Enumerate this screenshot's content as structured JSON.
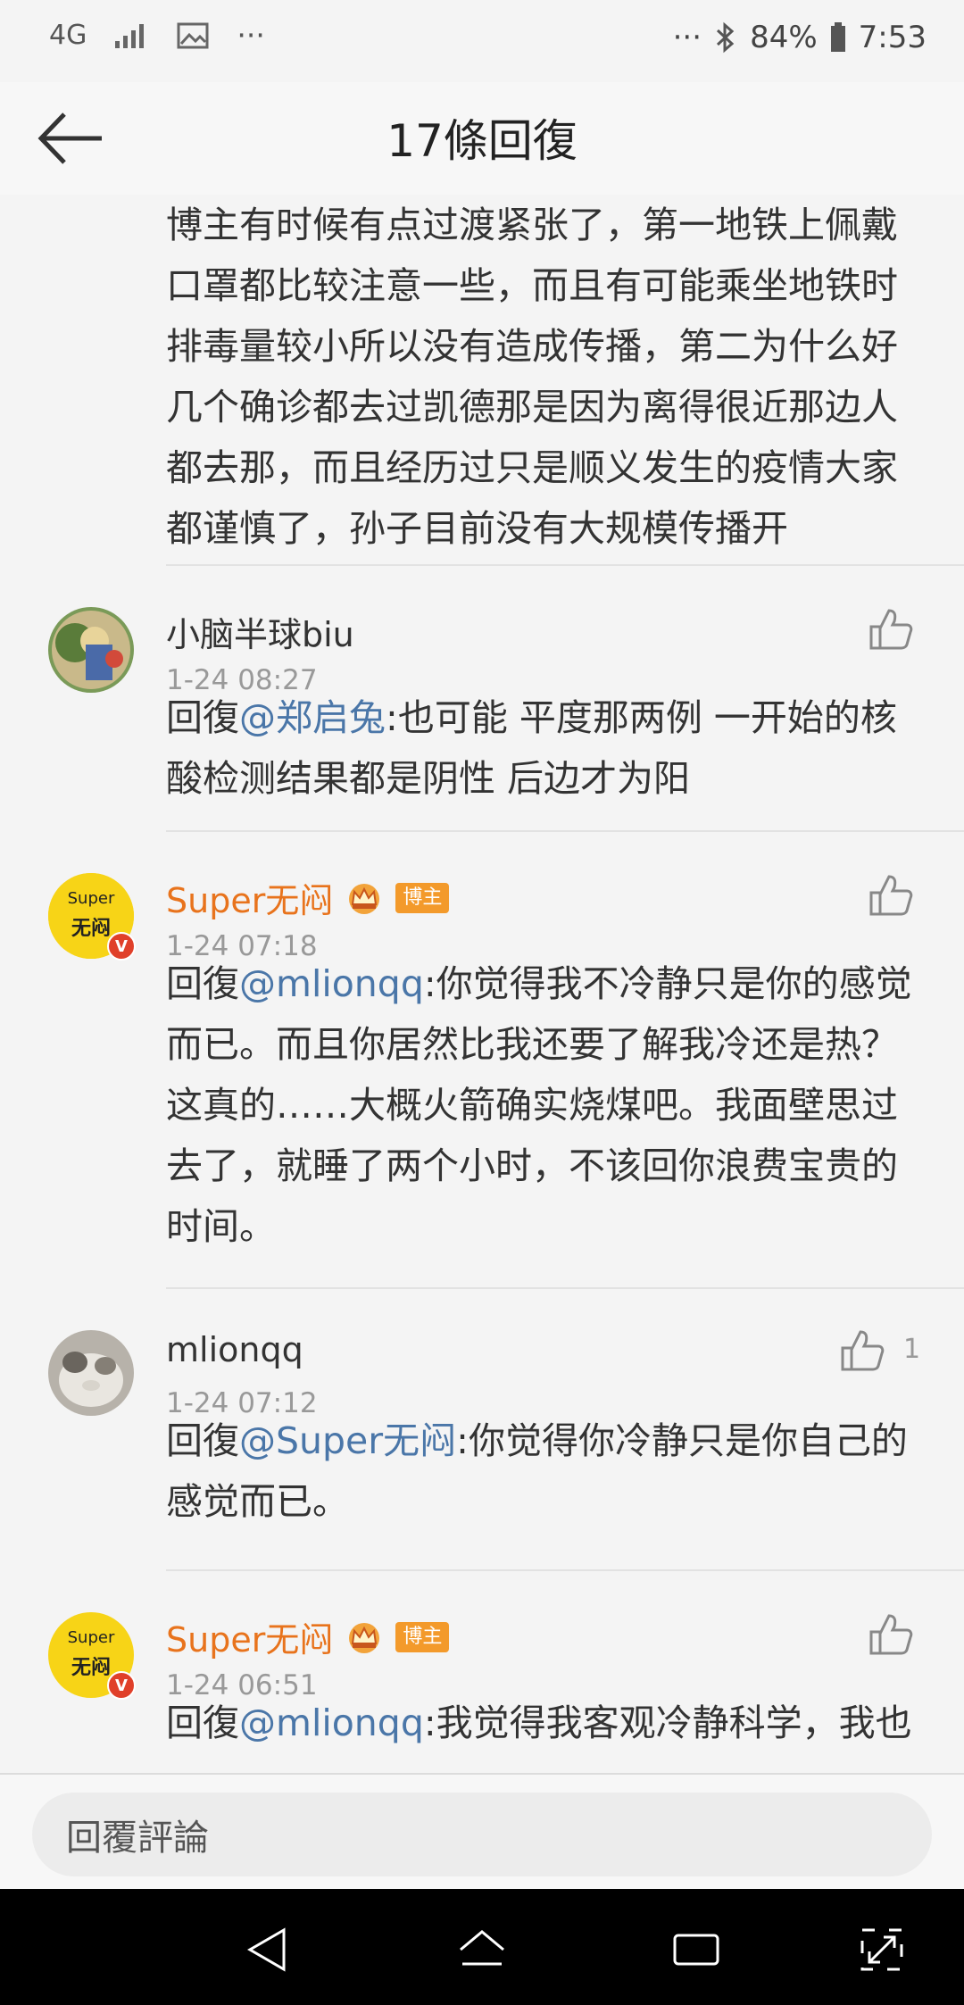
{
  "status_bar": {
    "network": "4G",
    "battery": "84%",
    "time": "7:53",
    "dots_left": "···",
    "dots_right": "···"
  },
  "header": {
    "title": "17條回復"
  },
  "first_comment_text": "博主有时候有点过渡紧张了，第一地铁上佩戴口罩都比较注意一些，而且有可能乘坐地铁时排毒量较小所以没有造成传播，第二为什么好几个确诊都去过凯德那是因为离得很近那边人都去那，而且经历过只是顺义发生的疫情大家都谨慎了，孙子目前没有大规模传播开",
  "comments": [
    {
      "name": "小脑半球biu",
      "time": "1-24 08:27",
      "reply_prefix": "回復",
      "mention": "@郑启兔",
      "text": ":也可能 平度那两例 一开始的核酸检测结果都是阴性 后边才为阳"
    },
    {
      "name": "Super无闷",
      "badge": "博主",
      "time": "1-24 07:18",
      "reply_prefix": "回復",
      "mention": "@mlionqq",
      "text": ":你觉得我不冷静只是你的感觉而已。而且你居然比我还要了解我冷还是热？这真的……大概火箭确实烧煤吧。我面壁思过去了，就睡了两个小时，不该回你浪费宝贵的时间。"
    },
    {
      "name": "mlionqq",
      "time": "1-24 07:12",
      "likes": "1",
      "reply_prefix": "回復",
      "mention": "@Super无闷",
      "text": ":你觉得你冷静只是你自己的感觉而已。"
    },
    {
      "name": "Super无闷",
      "badge": "博主",
      "time": "1-24 06:51",
      "reply_prefix": "回復",
      "mention": "@mlionqq",
      "text": ":我觉得我客观冷静科学，我也"
    }
  ],
  "avatar_text": {
    "super_top": "Super",
    "super_bottom": "无闷",
    "verified": "V"
  },
  "reply_bar": {
    "placeholder": "回覆評論"
  },
  "colors": {
    "host_name": "#e8731c",
    "mention": "#4a76a8",
    "badge": "#f39a2b"
  }
}
